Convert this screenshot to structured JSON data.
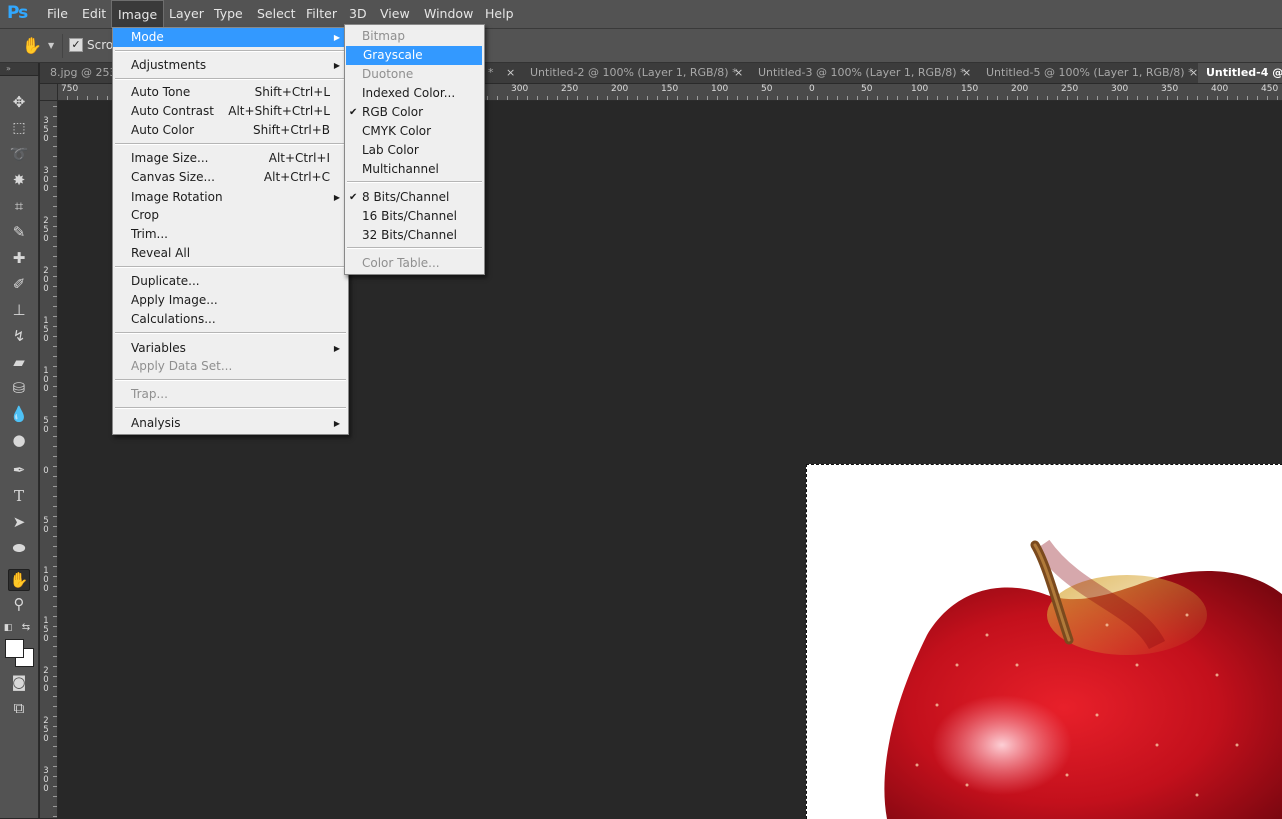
{
  "app": {
    "logo": "Ps"
  },
  "menubar": {
    "items": [
      "File",
      "Edit",
      "Image",
      "Layer",
      "Type",
      "Select",
      "Filter",
      "3D",
      "View",
      "Window",
      "Help"
    ],
    "active": "Image"
  },
  "options": {
    "scroll_label": "Scrol"
  },
  "tabs": [
    {
      "label": "8.jpg @ 253",
      "close": ""
    },
    {
      "label": "*",
      "close": "×"
    },
    {
      "label": "Untitled-2 @ 100% (Layer 1, RGB/8) *",
      "close": "×"
    },
    {
      "label": "Untitled-3 @ 100% (Layer 1, RGB/8) *",
      "close": "×"
    },
    {
      "label": "Untitled-5 @ 100% (Layer 1, RGB/8) *",
      "close": "×"
    },
    {
      "label": "Untitled-4 @",
      "close": ""
    }
  ],
  "ruler": {
    "top_labels": [
      "750",
      "300",
      "250",
      "200",
      "150",
      "100",
      "50",
      "0",
      "50",
      "100",
      "150",
      "200",
      "250",
      "300",
      "350",
      "400",
      "450"
    ],
    "left_labels": [
      "3 5 0",
      "3 0 0",
      "2 5 0",
      "2 0 0",
      "1 5 0",
      "1 0 0",
      "5 0",
      "0",
      "5 0",
      "1 0 0",
      "1 5 0",
      "2 0 0",
      "2 5 0",
      "3 0 0"
    ]
  },
  "image_menu": {
    "mode": "Mode",
    "adjustments": "Adjustments",
    "auto_tone": "Auto Tone",
    "auto_tone_sc": "Shift+Ctrl+L",
    "auto_contrast": "Auto Contrast",
    "auto_contrast_sc": "Alt+Shift+Ctrl+L",
    "auto_color": "Auto Color",
    "auto_color_sc": "Shift+Ctrl+B",
    "image_size": "Image Size...",
    "image_size_sc": "Alt+Ctrl+I",
    "canvas_size": "Canvas Size...",
    "canvas_size_sc": "Alt+Ctrl+C",
    "image_rotation": "Image Rotation",
    "crop": "Crop",
    "trim": "Trim...",
    "reveal_all": "Reveal All",
    "duplicate": "Duplicate...",
    "apply_image": "Apply Image...",
    "calculations": "Calculations...",
    "variables": "Variables",
    "apply_data_set": "Apply Data Set...",
    "trap": "Trap...",
    "analysis": "Analysis"
  },
  "mode_submenu": {
    "bitmap": "Bitmap",
    "grayscale": "Grayscale",
    "duotone": "Duotone",
    "indexed_color": "Indexed Color...",
    "rgb_color": "RGB Color",
    "cmyk_color": "CMYK Color",
    "lab_color": "Lab Color",
    "multichannel": "Multichannel",
    "bits8": "8 Bits/Channel",
    "bits16": "16 Bits/Channel",
    "bits32": "32 Bits/Channel",
    "color_table": "Color Table...",
    "check": "✔"
  },
  "colors": {
    "highlight": "#3399ff",
    "menu_bg": "#efefef",
    "chrome": "#535353",
    "canvas": "#282828",
    "apple_red": "#d0141e"
  }
}
